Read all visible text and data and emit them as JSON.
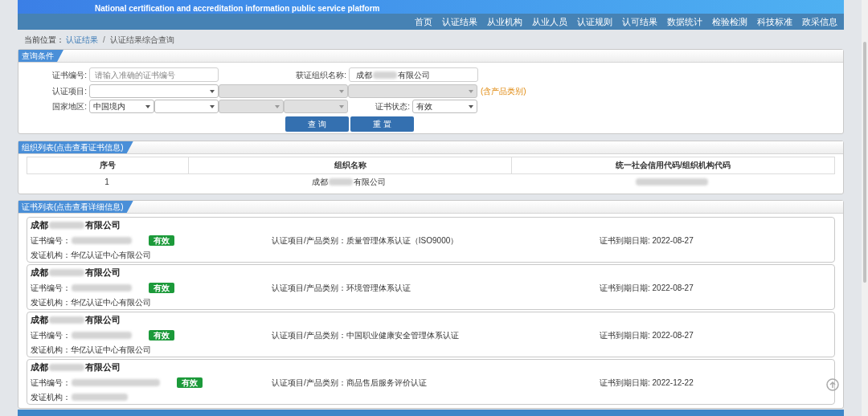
{
  "banner": {
    "subtitle": "National certification and accreditation information public service platform"
  },
  "nav": [
    {
      "label": "首页"
    },
    {
      "label": "认证结果"
    },
    {
      "label": "从业机构"
    },
    {
      "label": "从业人员"
    },
    {
      "label": "认证规则"
    },
    {
      "label": "认可结果"
    },
    {
      "label": "数据统计"
    },
    {
      "label": "检验检测"
    },
    {
      "label": "科技标准"
    },
    {
      "label": "政采信息"
    }
  ],
  "breadcrumb": {
    "label": "当前位置：",
    "link": "认证结果",
    "separator": "/",
    "current": "认证结果综合查询"
  },
  "query": {
    "title": "查询条件",
    "cert_no": {
      "label": "证书编号:",
      "placeholder": "请输入准确的证书编号"
    },
    "org_name": {
      "label": "获证组织名称:",
      "value_start": "成都",
      "value_end": "有限公司"
    },
    "project": {
      "label": "认证项目:",
      "selects": [
        {
          "disabled": false
        },
        {
          "disabled": true
        },
        {
          "disabled": true
        }
      ],
      "note": "(含产品类别)"
    },
    "region": {
      "label": "国家地区:",
      "selects": [
        {
          "value": "中国境内",
          "disabled": false
        },
        {
          "disabled": false
        },
        {
          "disabled": true
        },
        {
          "disabled": true
        }
      ]
    },
    "status": {
      "label": "证书状态:",
      "value": "有效"
    },
    "buttons": [
      "查 询",
      "重 置"
    ]
  },
  "orgs": {
    "title": "组织列表(点击查看证书信息)",
    "columns": [
      "序号",
      "组织名称",
      "统一社会信用代码/组织机构代码"
    ],
    "rows": [
      {
        "index": "1",
        "name_start": "成都",
        "name_end": "有限公司"
      }
    ]
  },
  "certs": {
    "title": "证书列表(点击查看详细信息)",
    "items": [
      {
        "name_start": "成都",
        "name_end": "有限公司",
        "no_label": "证书编号：",
        "status": "有效",
        "project_label": "认证项目/产品类别：",
        "project": "质量管理体系认证（ISO9000）",
        "expiry_label": "证书到期日期:",
        "expiry": "2022-08-27",
        "issuer_label": "发证机构：",
        "issuer": "华亿认证中心有限公司"
      },
      {
        "name_start": "成都",
        "name_end": "有限公司",
        "no_label": "证书编号：",
        "status": "有效",
        "project_label": "认证项目/产品类别：",
        "project": "环境管理体系认证",
        "expiry_label": "证书到期日期:",
        "expiry": "2022-08-27",
        "issuer_label": "发证机构：",
        "issuer": "华亿认证中心有限公司"
      },
      {
        "name_start": "成都",
        "name_end": "有限公司",
        "no_label": "证书编号：",
        "status": "有效",
        "project_label": "认证项目/产品类别：",
        "project": "中国职业健康安全管理体系认证",
        "expiry_label": "证书到期日期:",
        "expiry": "2022-08-27",
        "issuer_label": "发证机构：",
        "issuer": "华亿认证中心有限公司"
      },
      {
        "name_start": "成都",
        "name_end": "有限公司",
        "no_label": "证书编号：",
        "status": "有效",
        "project_label": "认证项目/产品类别：",
        "project": "商品售后服务评价认证",
        "expiry_label": "证书到期日期:",
        "expiry": "2022-12-22",
        "issuer_label": "发证机构："
      }
    ]
  }
}
